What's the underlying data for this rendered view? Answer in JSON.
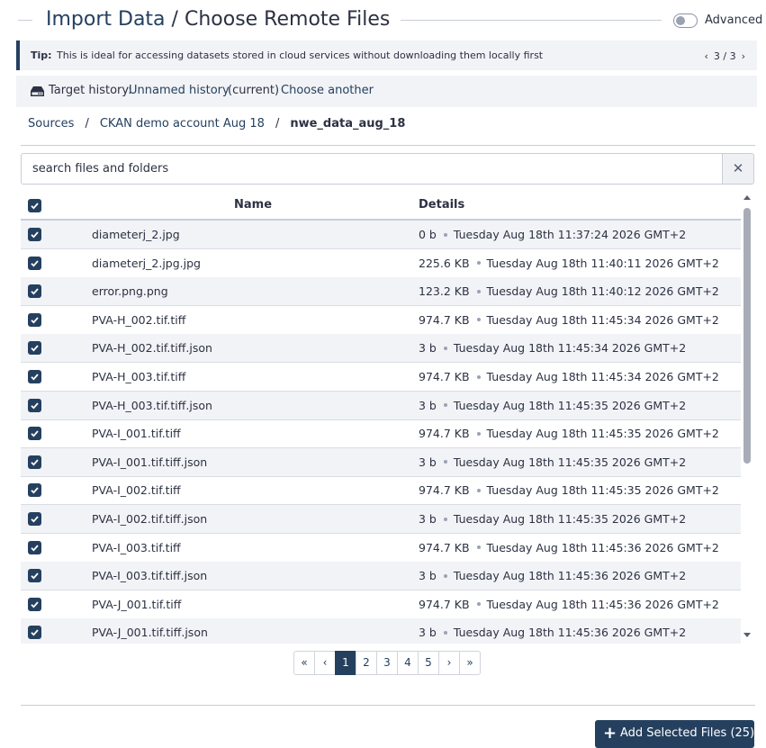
{
  "header": {
    "title_link": "Import Data",
    "title_separator": "/",
    "title_current": "Choose Remote Files",
    "advanced_label": "Advanced",
    "advanced_on": false
  },
  "tip": {
    "label": "Tip:",
    "text": "This is ideal for accessing datasets stored in cloud services without downloading them locally first",
    "prev": "‹",
    "counter": "3 / 3",
    "next": "›"
  },
  "history": {
    "icon": "hard-drive-icon",
    "label": "Target history:",
    "name": "Unnamed history",
    "status": "(current)",
    "choose": "Choose another"
  },
  "breadcrumb": {
    "items": [
      "Sources",
      "CKAN demo account Aug 18",
      "nwe_data_aug_18"
    ],
    "separator": "/"
  },
  "search": {
    "placeholder": "search files and folders",
    "value": "",
    "clear_label": "✕"
  },
  "table": {
    "columns": {
      "name": "Name",
      "details": "Details"
    },
    "rows": [
      {
        "name": "diameterj_2.jpg",
        "size": "0 b",
        "date": "Tuesday Aug 18th 11:37:24 2026 GMT+2",
        "checked": true
      },
      {
        "name": "diameterj_2.jpg.jpg",
        "size": "225.6 KB",
        "date": "Tuesday Aug 18th 11:40:11 2026 GMT+2",
        "checked": true
      },
      {
        "name": "error.png.png",
        "size": "123.2 KB",
        "date": "Tuesday Aug 18th 11:40:12 2026 GMT+2",
        "checked": true
      },
      {
        "name": "PVA-H_002.tif.tiff",
        "size": "974.7 KB",
        "date": "Tuesday Aug 18th 11:45:34 2026 GMT+2",
        "checked": true
      },
      {
        "name": "PVA-H_002.tif.tiff.json",
        "size": "3 b",
        "date": "Tuesday Aug 18th 11:45:34 2026 GMT+2",
        "checked": true
      },
      {
        "name": "PVA-H_003.tif.tiff",
        "size": "974.7 KB",
        "date": "Tuesday Aug 18th 11:45:34 2026 GMT+2",
        "checked": true
      },
      {
        "name": "PVA-H_003.tif.tiff.json",
        "size": "3 b",
        "date": "Tuesday Aug 18th 11:45:35 2026 GMT+2",
        "checked": true
      },
      {
        "name": "PVA-I_001.tif.tiff",
        "size": "974.7 KB",
        "date": "Tuesday Aug 18th 11:45:35 2026 GMT+2",
        "checked": true
      },
      {
        "name": "PVA-I_001.tif.tiff.json",
        "size": "3 b",
        "date": "Tuesday Aug 18th 11:45:35 2026 GMT+2",
        "checked": true
      },
      {
        "name": "PVA-I_002.tif.tiff",
        "size": "974.7 KB",
        "date": "Tuesday Aug 18th 11:45:35 2026 GMT+2",
        "checked": true
      },
      {
        "name": "PVA-I_002.tif.tiff.json",
        "size": "3 b",
        "date": "Tuesday Aug 18th 11:45:35 2026 GMT+2",
        "checked": true
      },
      {
        "name": "PVA-I_003.tif.tiff",
        "size": "974.7 KB",
        "date": "Tuesday Aug 18th 11:45:36 2026 GMT+2",
        "checked": true
      },
      {
        "name": "PVA-I_003.tif.tiff.json",
        "size": "3 b",
        "date": "Tuesday Aug 18th 11:45:36 2026 GMT+2",
        "checked": true
      },
      {
        "name": "PVA-J_001.tif.tiff",
        "size": "974.7 KB",
        "date": "Tuesday Aug 18th 11:45:36 2026 GMT+2",
        "checked": true
      },
      {
        "name": "PVA-J_001.tif.tiff.json",
        "size": "3 b",
        "date": "Tuesday Aug 18th 11:45:36 2026 GMT+2",
        "checked": true
      }
    ]
  },
  "pagination": {
    "first": "«",
    "prev": "‹",
    "pages": [
      "1",
      "2",
      "3",
      "4",
      "5"
    ],
    "current": "1",
    "next": "›",
    "last": "»"
  },
  "footer": {
    "add_icon": "+",
    "add_label": "Add Selected Files (25)"
  },
  "colors": {
    "primary": "#25405f",
    "stripe": "#f1f3f6",
    "border": "#c8cdd8"
  }
}
